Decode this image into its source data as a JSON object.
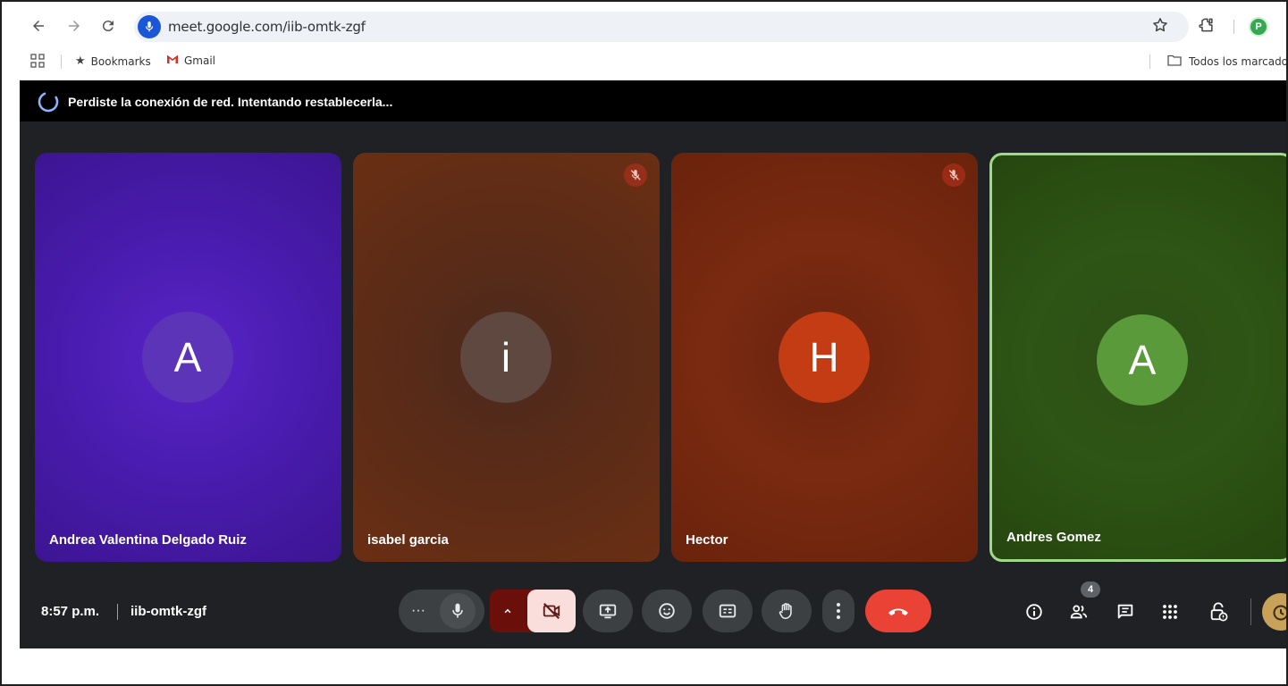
{
  "browser": {
    "url": "meet.google.com/iib-omtk-zgf",
    "profile_initial": "P",
    "bookmarks_bar": {
      "bookmarks_label": "Bookmarks",
      "gmail_label": "Gmail",
      "all_bookmarks_label": "Todos los marcador"
    }
  },
  "meet": {
    "banner_text": "Perdiste la conexión de red. Intentando restablecerla...",
    "participants": [
      {
        "name": "Andrea Valentina Delgado Ruiz",
        "initial": "A",
        "muted": false,
        "color": "#4a1cb0"
      },
      {
        "name": "isabel garcia",
        "initial": "i",
        "muted": true,
        "color": "#5a2b17"
      },
      {
        "name": "Hector",
        "initial": "H",
        "muted": true,
        "color": "#7a2a10"
      },
      {
        "name": "Andres Gomez",
        "initial": "A",
        "muted": false,
        "color": "#2e5515",
        "speaking": true
      }
    ],
    "footer": {
      "time": "8:57 p.m.",
      "meeting_code": "iib-omtk-zgf",
      "people_count": "4"
    }
  },
  "icons": {
    "back": "back-arrow-icon",
    "forward": "forward-arrow-icon",
    "reload": "reload-icon",
    "site": "microphone-icon",
    "star": "star-icon",
    "extensions": "puzzle-icon",
    "apps": "apps-grid-icon",
    "folder": "folder-icon",
    "spinner": "loading-spinner-icon",
    "mic_off": "mic-off-icon",
    "mic": "mic-icon",
    "cam_off": "camera-off-icon",
    "present": "present-screen-icon",
    "emoji": "emoji-icon",
    "captions": "captions-icon",
    "hand": "raise-hand-icon",
    "more": "more-vert-icon",
    "leave": "hang-up-icon",
    "info": "info-icon",
    "people": "people-icon",
    "chat": "chat-icon",
    "activities": "activities-grid-icon",
    "host": "host-controls-icon",
    "timer": "timer-icon"
  },
  "colors": {
    "meet_bg": "#202124",
    "leave_red": "#ea4335",
    "cam_off_bg": "#f9dedc",
    "speaking_border": "#9fd98a"
  }
}
